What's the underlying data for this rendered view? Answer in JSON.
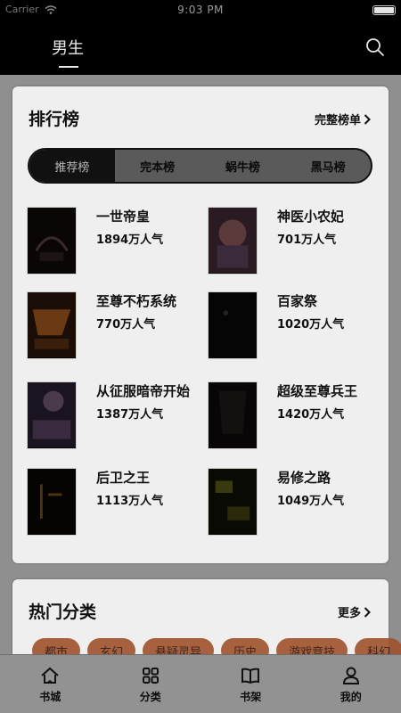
{
  "status_bar": {
    "time": "9:03 PM",
    "carrier": "Carrier"
  },
  "top_nav": {
    "tab": "男生"
  },
  "ranking": {
    "title": "排行榜",
    "more": "完整榜单",
    "tabs": [
      "推荐榜",
      "完本榜",
      "蜗牛榜",
      "黑马榜"
    ],
    "books": [
      {
        "name": "一世帝皇",
        "popularity": "1894万人气"
      },
      {
        "name": "神医小农妃",
        "popularity": "701万人气"
      },
      {
        "name": "至尊不朽系统",
        "popularity": "770万人气"
      },
      {
        "name": "百家祭",
        "popularity": "1020万人气"
      },
      {
        "name": "从征服暗帝开始",
        "popularity": "1387万人气"
      },
      {
        "name": "超级至尊兵王",
        "popularity": "1420万人气"
      },
      {
        "name": "后卫之王",
        "popularity": "1113万人气"
      },
      {
        "name": "易修之路",
        "popularity": "1049万人气"
      }
    ]
  },
  "hot_categories": {
    "title": "热门分类",
    "more": "更多",
    "chips": [
      "都市",
      "玄幻",
      "悬疑灵异",
      "历史",
      "游戏竞技",
      "科幻"
    ]
  },
  "tab_bar": {
    "items": [
      {
        "label": "书城",
        "icon": "home-icon"
      },
      {
        "label": "分类",
        "icon": "grid-icon"
      },
      {
        "label": "书架",
        "icon": "book-icon"
      },
      {
        "label": "我的",
        "icon": "user-icon"
      }
    ]
  }
}
